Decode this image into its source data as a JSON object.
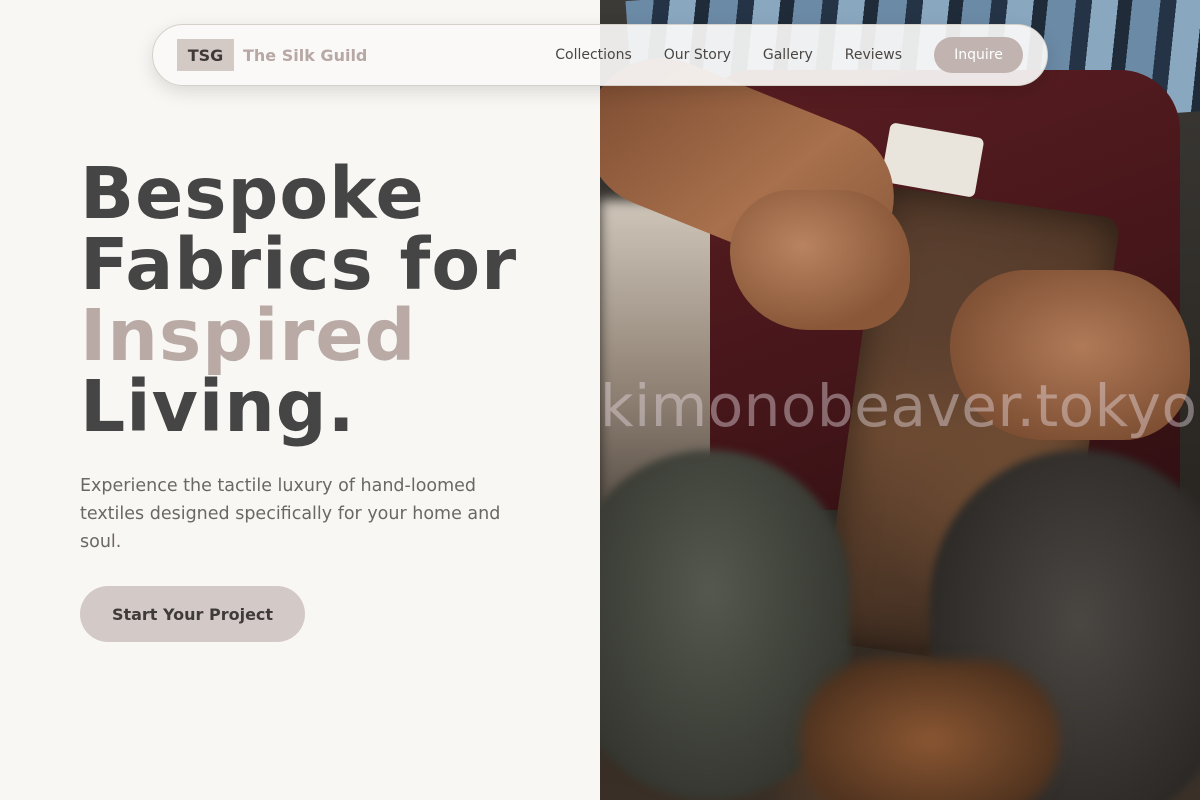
{
  "nav": {
    "logo_mark": "TSG",
    "brand_name": "The Silk Guild",
    "links": [
      "Collections",
      "Our Story",
      "Gallery",
      "Reviews"
    ],
    "cta_label": "Inquire"
  },
  "hero": {
    "headline_line1": "Bespoke",
    "headline_line2": "Fabrics for",
    "headline_accent": "Inspired",
    "headline_line4": "Living.",
    "description": "Experience the tactile luxury of hand-loomed textiles designed specifically for your home and soul.",
    "cta_label": "Start Your Project"
  },
  "photo": {
    "watermark": "kimonobeaver.tokyo"
  },
  "colors": {
    "background": "#f9f7f4",
    "accent": "#b9aaa6",
    "heading": "#454545",
    "button": "#d3c9c6"
  }
}
